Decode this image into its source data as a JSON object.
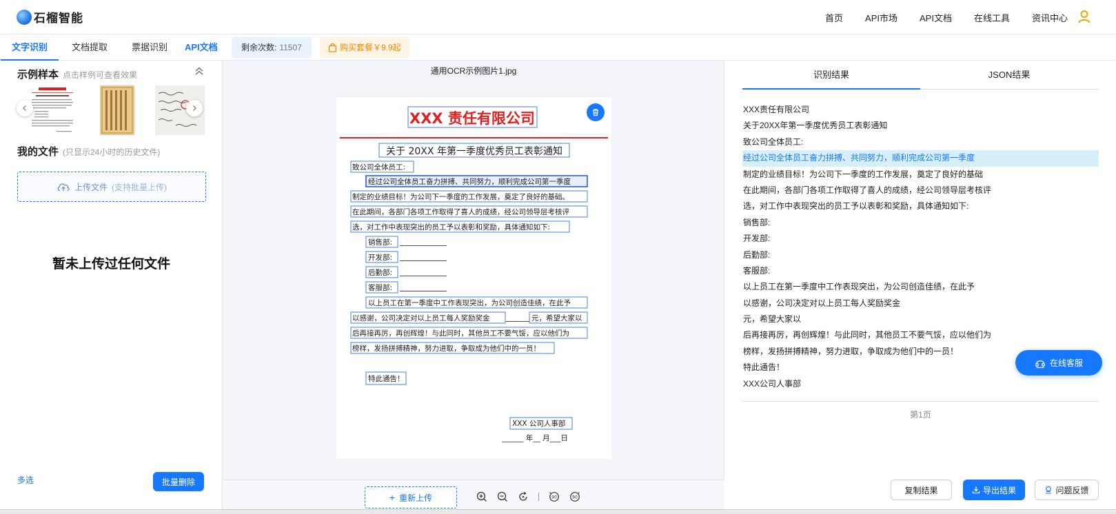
{
  "header": {
    "brand": "石榴智能",
    "nav": [
      "首页",
      "API市场",
      "API文档",
      "在线工具",
      "资讯中心"
    ]
  },
  "tabs": {
    "items": [
      "文字识别",
      "文档提取",
      "票据识别"
    ],
    "api_doc": "API文档",
    "remain_label": "剩余次数:",
    "remain_value": "11507",
    "buy_label": "购买套餐￥9.9起"
  },
  "left": {
    "samples_title": "示例样本",
    "samples_hint": "点击样例可查看效果",
    "my_files_title": "我的文件",
    "my_files_hint": "(只显示24小时的历史文件)",
    "upload_label": "上传文件",
    "upload_hint": "(支持批量上传)",
    "empty_text": "暂未上传过任何文件",
    "multi_select": "多选",
    "batch_delete": "批量删除"
  },
  "middle": {
    "filename": "通用OCR示例图片1.jpg",
    "reupload": "重新上传",
    "doc": {
      "company": "XXX 责任有限公司",
      "title": "关于 20XX 年第一季度优秀员工表彰通知",
      "greeting": "致公司全体员工:",
      "p1": "经过公司全体员工奋力拼搏、共同努力，顺利完成公司第一季度",
      "p2": "制定的业绩目标！为公司下一季度的工作发展，奠定了良好的基础。",
      "p3": "在此期间，各部门各项工作取得了喜人的成绩，经公司领导层考核评",
      "p4": "选，对工作中表现突出的员工予以表彰和奖励，具体通知如下:",
      "d1": "销售部:",
      "d2": "开发部:",
      "d3": "后勤部:",
      "d4": "客服部:",
      "p5": "以上员工在第一季度中工作表现突出，为公司创造佳绩，在此予",
      "p6a": "以感谢，公司决定对以上员工每人奖励奖金",
      "p6b": "元，希望大家以",
      "p7": "后再接再厉，再创辉煌！与此同时，其他员工不要气馁，应以他们为",
      "p8": "榜样，发扬拼搏精神，努力进取，争取成为他们中的一员！",
      "notice": "特此通告！",
      "sign": "XXX 公司人事部",
      "date": "______ 年__ 月___日"
    }
  },
  "right": {
    "tab_result": "识别结果",
    "tab_json": "JSON结果",
    "lines": [
      "XXX责任有限公司",
      "关于20XX年第一季度优秀员工表彰通知",
      "致公司全体员工:",
      "经过公司全体员工奋力拼搏、共同努力，顺利完成公司第一季度",
      "制定的业绩目标！为公司下一季度的工作发展，奠定了良好的基础",
      "在此期间，各部门各项工作取得了喜人的成绩，经公司领导层考核评",
      "选，对工作中表现突出的员工予以表彰和奖励，具体通知如下:",
      "销售部:",
      "开发部:",
      "后勤部:",
      "客服部:",
      "以上员工在第一季度中工作表现突出，为公司创造佳绩，在此予",
      "以感谢，公司决定对以上员工每人奖励奖金",
      "元，希望大家以",
      "后再接再厉，再创辉煌！与此同时，其他员工不要气馁，应以他们为",
      "榜样，发扬拼搏精神，努力进取，争取成为他们中的一员！",
      "特此通告！",
      "XXX公司人事部"
    ],
    "page": "第1页",
    "copy": "复制结果",
    "export": "导出结果",
    "feedback": "问题反馈",
    "service": "在线客服"
  },
  "colors": {
    "accent": "#1677ff",
    "highlight_bg": "#d6effb",
    "buy_text": "#f08a00",
    "doc_red": "#e02020"
  }
}
